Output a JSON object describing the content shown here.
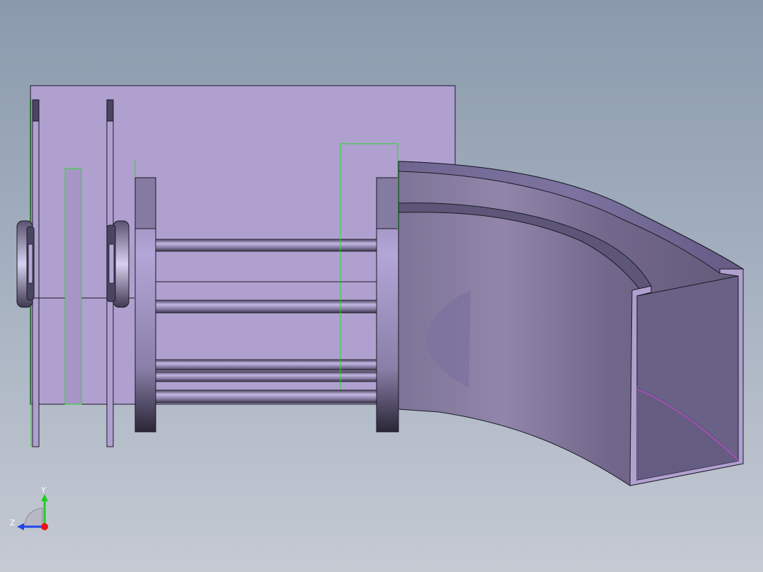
{
  "viewport": {
    "background_top": "#8a9aac",
    "background_bottom": "#c5cad3"
  },
  "model": {
    "body_color": "#b0a0d0",
    "edge_color": "#1a1a24",
    "sketch_line_color": "#22dd22",
    "highlight_curve_color": "#cc44cc"
  },
  "triad": {
    "y_label": "Y",
    "z_label": "Z",
    "y_axis_color": "#22cc22",
    "z_axis_color": "#2244ee",
    "origin_color": "#ee1111"
  }
}
